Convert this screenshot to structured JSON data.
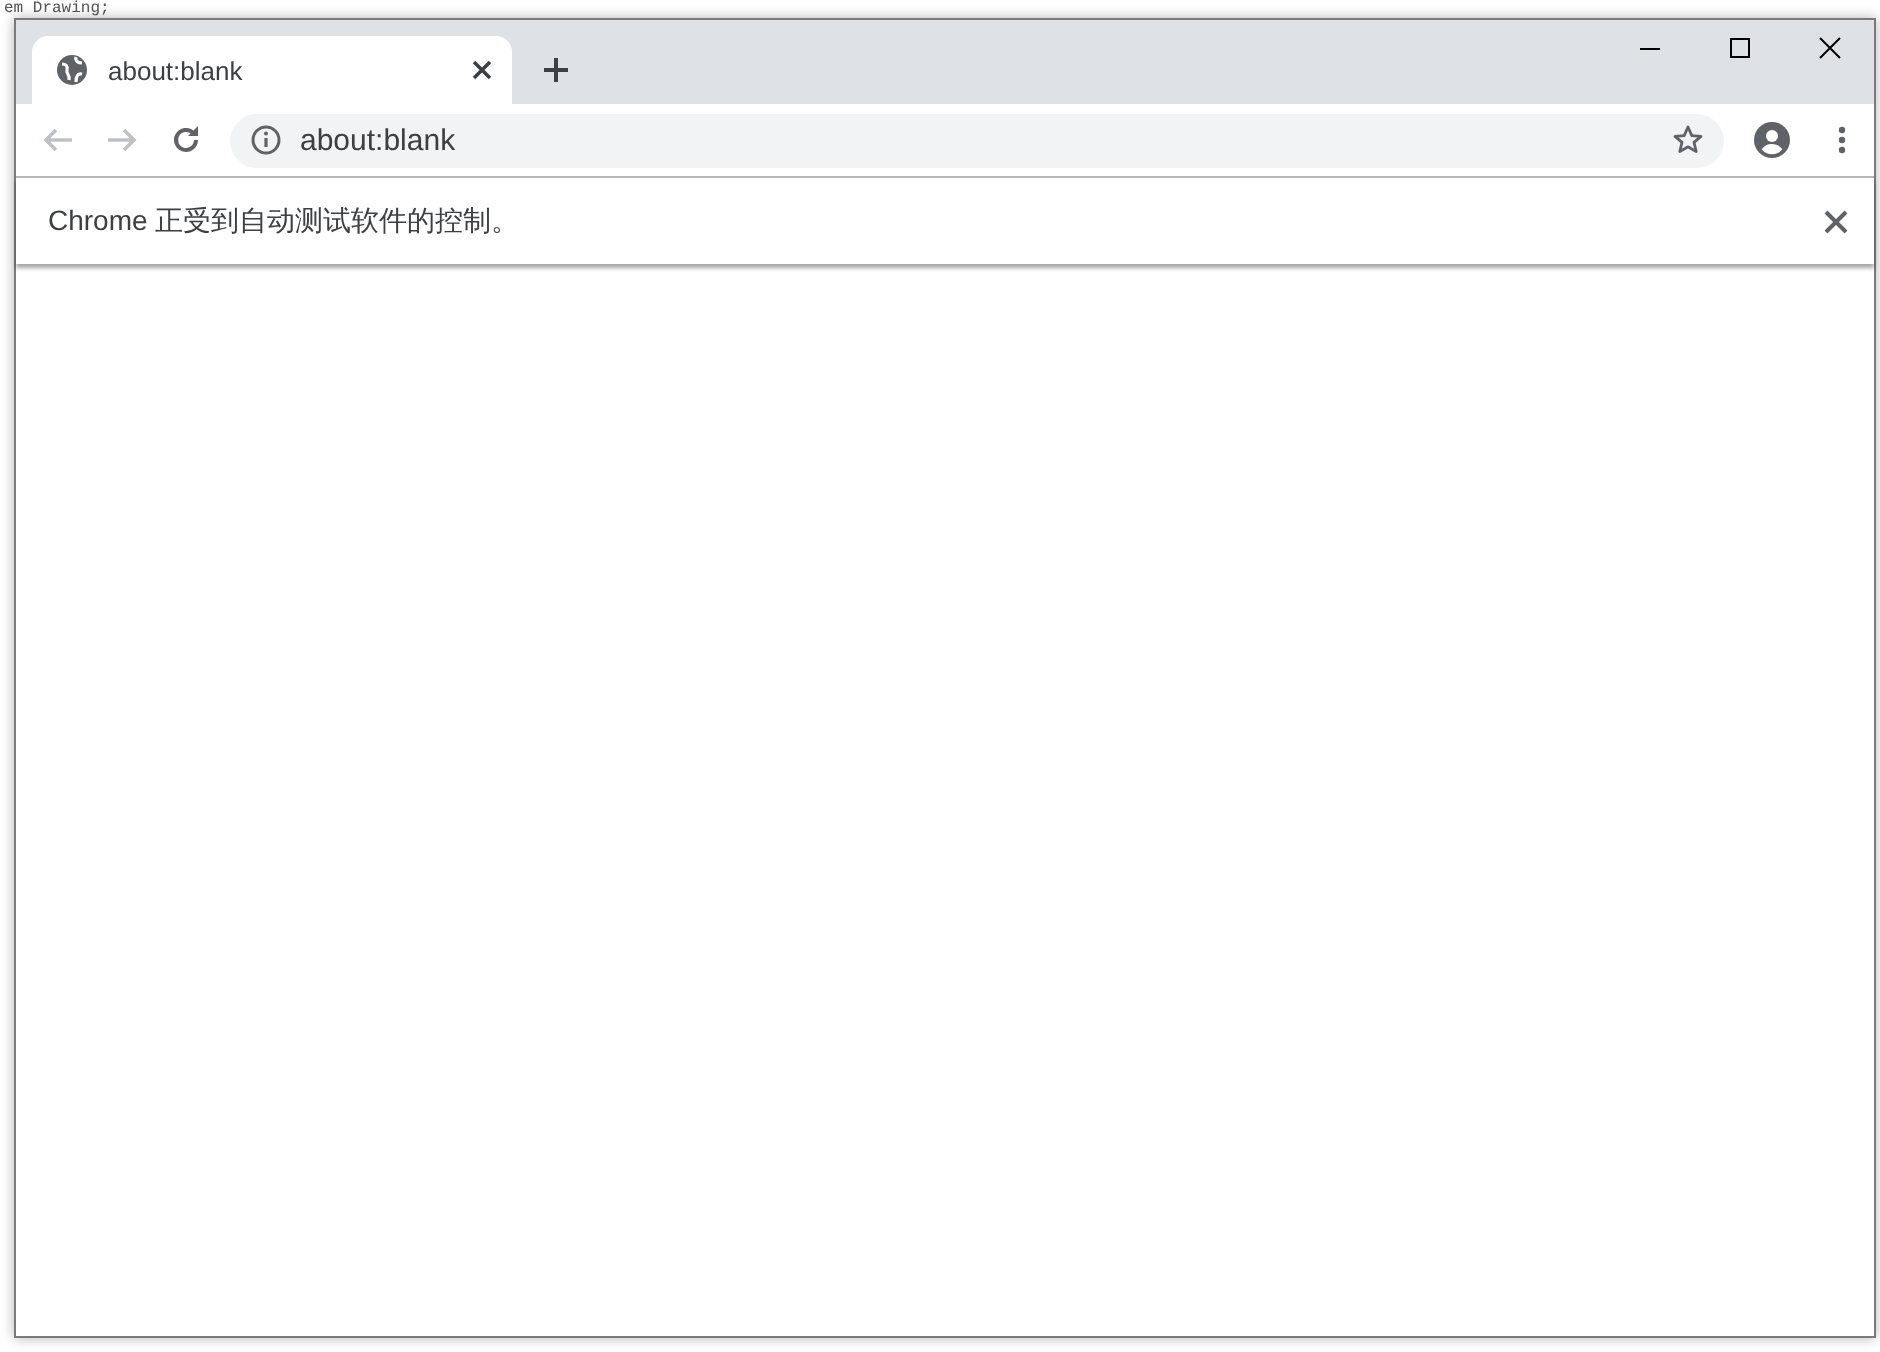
{
  "background_text": "em Drawing;",
  "tabs": [
    {
      "title": "about:blank",
      "selected": true
    }
  ],
  "nav_buttons": [
    {
      "kind": "back",
      "disabled": true
    },
    {
      "kind": "forward",
      "disabled": true
    },
    {
      "kind": "reload",
      "disabled": false
    }
  ],
  "address_bar": {
    "value": "about:blank"
  },
  "infobar": {
    "message": "Chrome 正受到自动测试软件的控制。"
  }
}
